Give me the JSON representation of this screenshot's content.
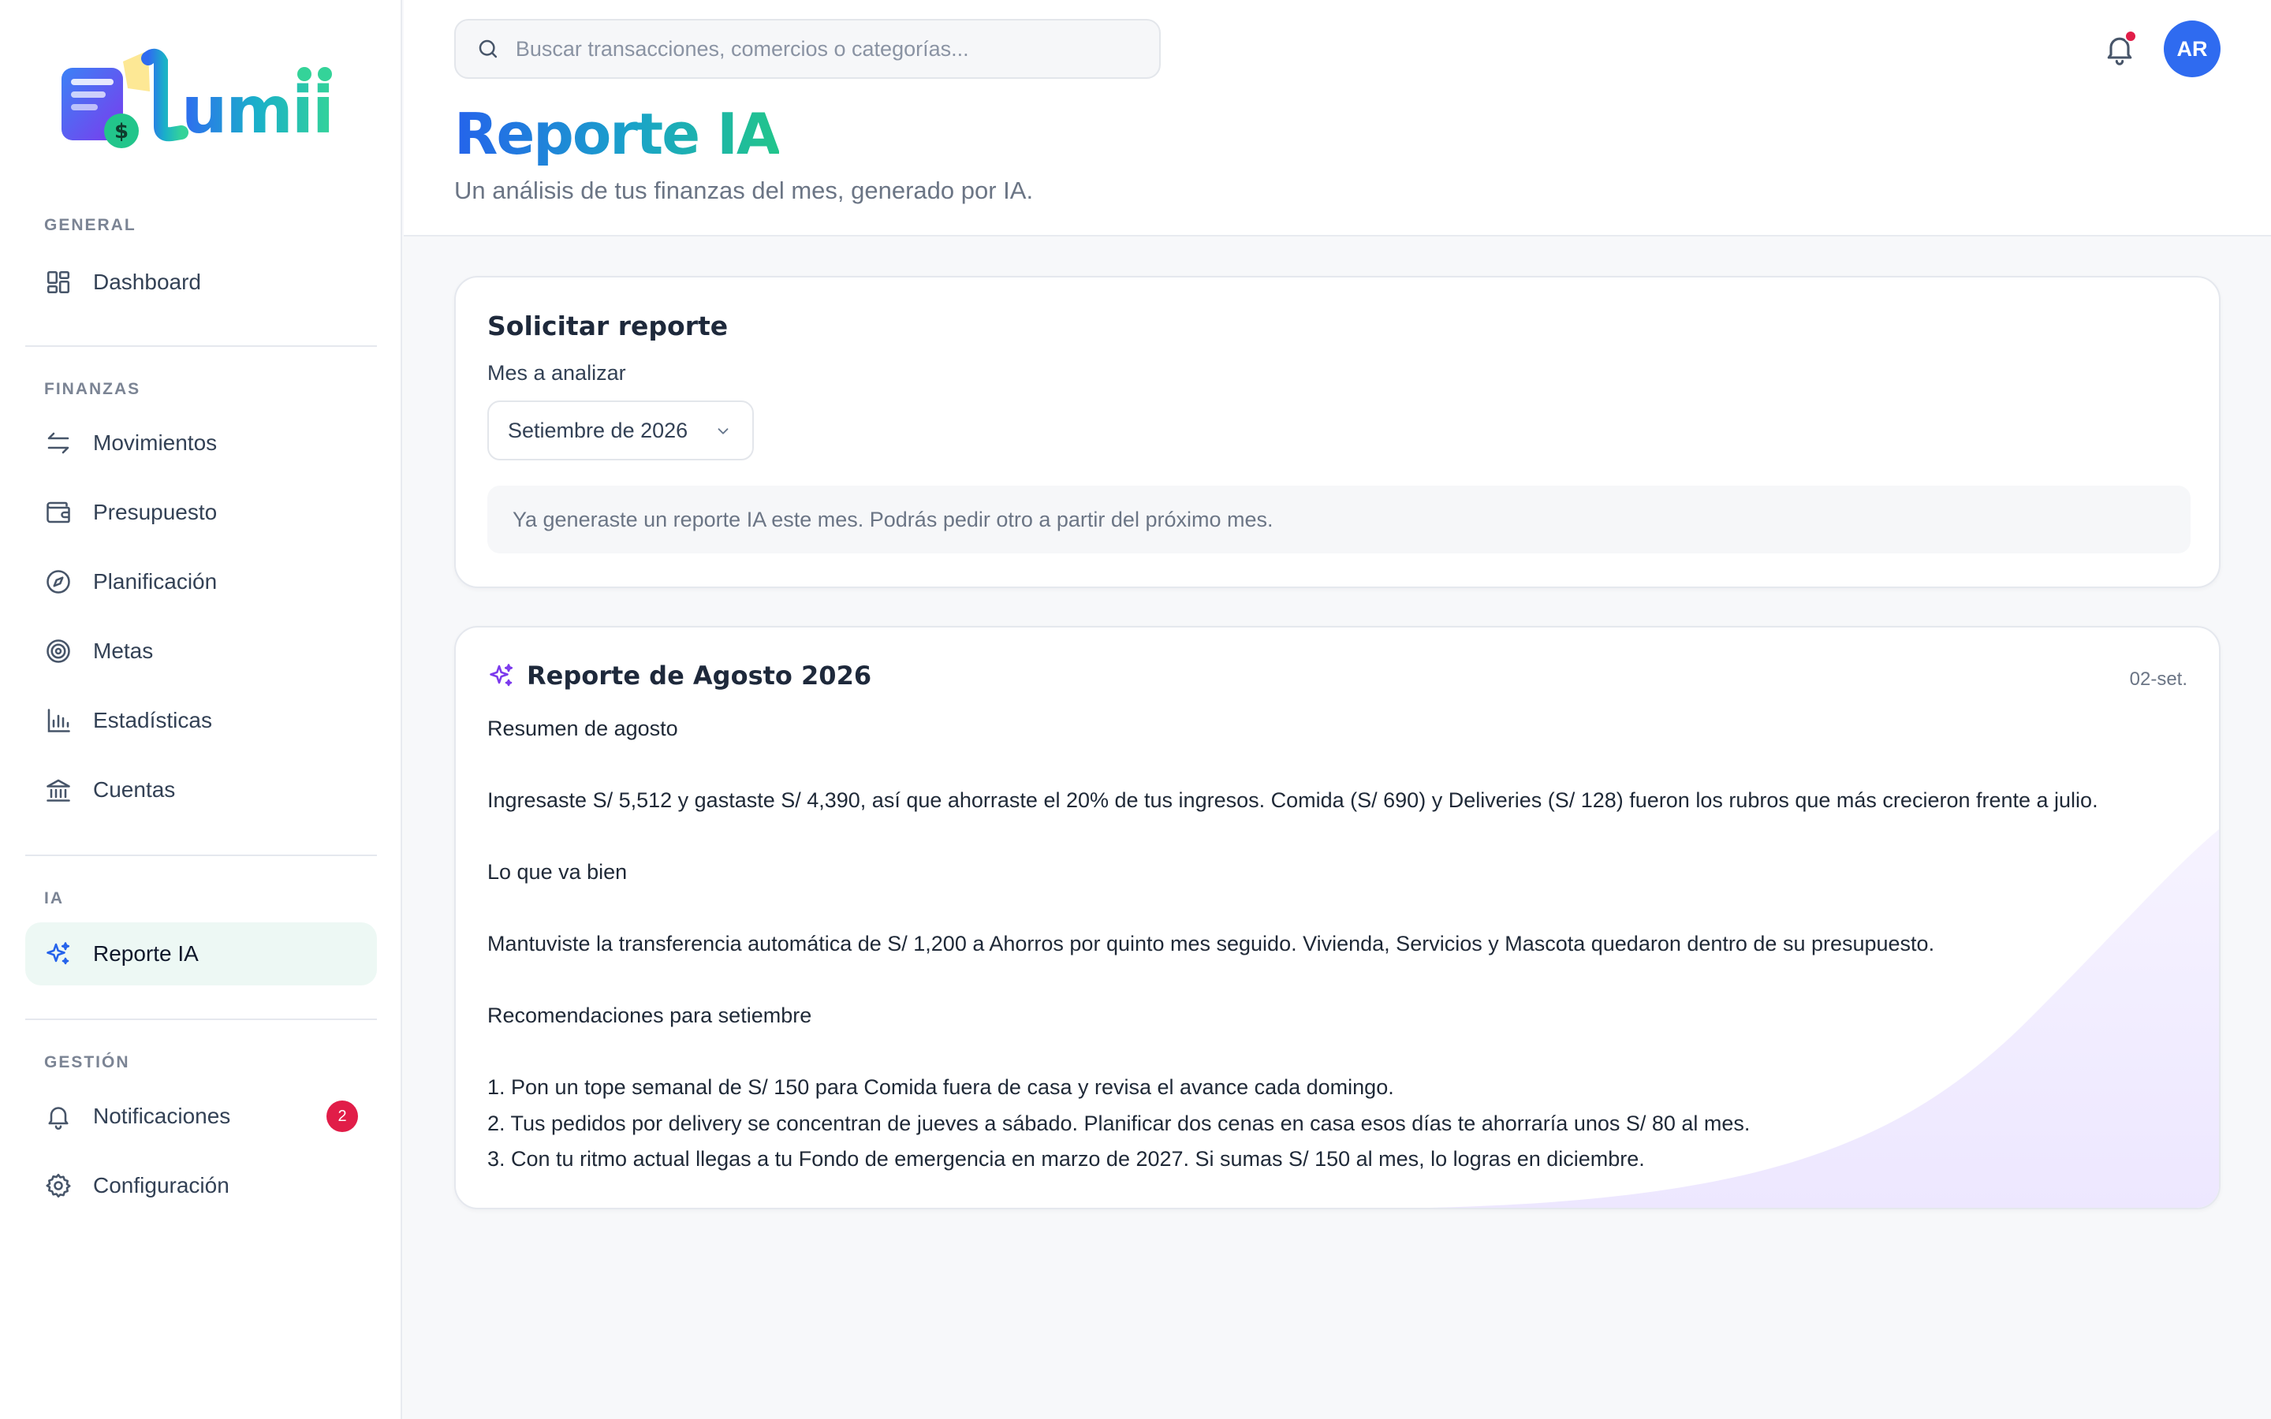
{
  "brand": {
    "name": "lumii",
    "accent": "#2563eb",
    "accent_green": "#22c58b"
  },
  "sidebar": {
    "sections": [
      {
        "title": "GENERAL",
        "items": [
          {
            "label": "Dashboard",
            "icon": "grid-icon"
          }
        ]
      },
      {
        "title": "FINANZAS",
        "items": [
          {
            "label": "Movimientos",
            "icon": "arrows-icon"
          },
          {
            "label": "Presupuesto",
            "icon": "wallet-icon"
          },
          {
            "label": "Planificación",
            "icon": "compass-icon"
          },
          {
            "label": "Metas",
            "icon": "target-icon"
          },
          {
            "label": "Estadísticas",
            "icon": "bar-chart-icon"
          },
          {
            "label": "Cuentas",
            "icon": "bank-icon"
          }
        ]
      },
      {
        "title": "IA",
        "items": [
          {
            "label": "Reporte IA",
            "icon": "sparkles-icon",
            "active": true
          }
        ]
      },
      {
        "title": "GESTIÓN",
        "items": [
          {
            "label": "Notificaciones",
            "icon": "bell-icon",
            "badge": "2"
          },
          {
            "label": "Configuración",
            "icon": "gear-icon"
          }
        ]
      }
    ]
  },
  "topbar": {
    "search_placeholder": "Buscar transacciones, comercios o categorías...",
    "avatar_initials": "AR",
    "has_notification_dot": true
  },
  "header": {
    "title": "Reporte IA",
    "subtitle": "Un análisis de tus finanzas del mes, generado por IA."
  },
  "request_card": {
    "title": "Solicitar reporte",
    "month_label": "Mes a analizar",
    "month_value": "Setiembre de 2026",
    "notice": "Ya generaste un reporte IA este mes. Podrás pedir otro a partir del próximo mes."
  },
  "report_card": {
    "title": "Reporte de Agosto 2026",
    "date": "02-set.",
    "lines": [
      "Resumen de agosto",
      "",
      "Ingresaste S/ 5,512 y gastaste S/ 4,390, así que ahorraste el 20% de tus ingresos. Comida (S/ 690) y Deliveries (S/ 128) fueron los rubros que más crecieron frente a julio.",
      "",
      "Lo que va bien",
      "",
      "Mantuviste la transferencia automática de S/ 1,200 a Ahorros por quinto mes seguido. Vivienda, Servicios y Mascota quedaron dentro de su presupuesto.",
      "",
      "Recomendaciones para setiembre",
      "",
      "1. Pon un tope semanal de S/ 150 para Comida fuera de casa y revisa el avance cada domingo.",
      "2. Tus pedidos por delivery se concentran de jueves a sábado. Planificar dos cenas en casa esos días te ahorraría unos S/ 80 al mes.",
      "3. Con tu ritmo actual llegas a tu Fondo de emergencia en marzo de 2027. Si sumas S/ 150 al mes, lo logras en diciembre."
    ]
  }
}
